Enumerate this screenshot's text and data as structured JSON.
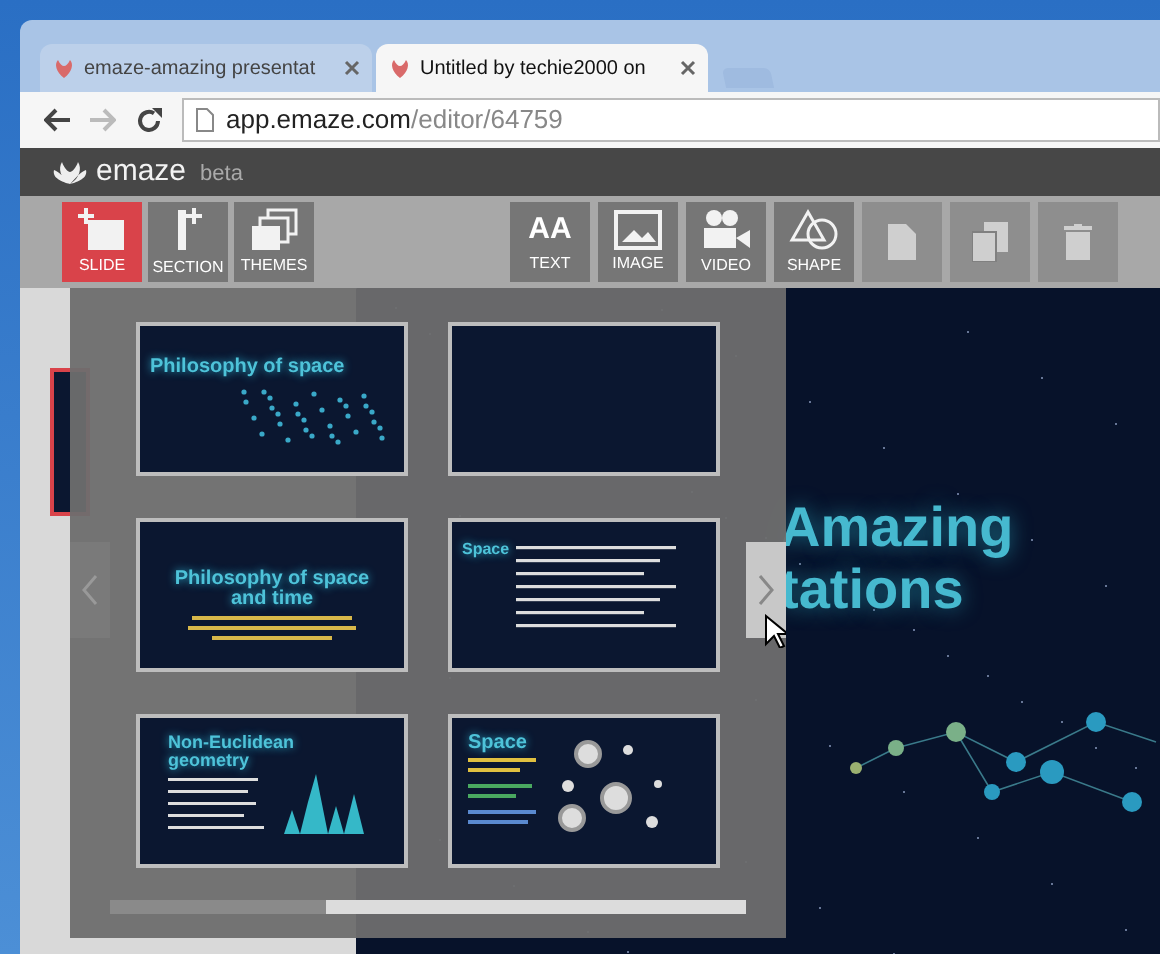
{
  "browser": {
    "tabs": [
      {
        "title": "emaze-amazing presentat",
        "selected": false
      },
      {
        "title": "Untitled by techie2000 on",
        "selected": true
      }
    ],
    "url_host": "app.emaze.com",
    "url_path": "/editor/64759"
  },
  "app": {
    "logo": "emaze",
    "badge": "beta"
  },
  "toolbar": {
    "left": [
      {
        "label": "SLIDE",
        "selected": true
      },
      {
        "label": "SECTION",
        "selected": false
      },
      {
        "label": "THEMES",
        "selected": false
      }
    ],
    "right": [
      {
        "label": "TEXT",
        "glyph": "AA"
      },
      {
        "label": "IMAGE"
      },
      {
        "label": "VIDEO"
      },
      {
        "label": "SHAPE"
      },
      {
        "kind": "icon"
      },
      {
        "kind": "icon"
      },
      {
        "kind": "icon"
      }
    ]
  },
  "slide_picker": {
    "slides": [
      {
        "kind": "title",
        "title": "Philosophy of space"
      },
      {
        "kind": "blank"
      },
      {
        "kind": "center",
        "title": "Philosophy of space and time"
      },
      {
        "kind": "text",
        "title": "Space"
      },
      {
        "kind": "chart",
        "title": "Non-Euclidean geometry"
      },
      {
        "kind": "stats",
        "title": "Space"
      }
    ]
  },
  "canvas": {
    "title_lines": [
      "Amazing",
      "tations"
    ]
  }
}
